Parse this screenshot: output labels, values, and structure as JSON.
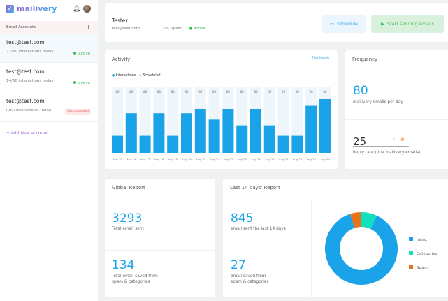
{
  "app": {
    "name": "mailivery",
    "brand_color": "#1aa3e8"
  },
  "sidebar": {
    "section_title": "Email Accounts",
    "add_icon": "plus-icon",
    "accounts": [
      {
        "email": "test@test.com",
        "interactions": "22/80 interactions today",
        "status": "active",
        "selected": true
      },
      {
        "email": "test@test.com",
        "interactions": "14/50 interactions today",
        "status": "active"
      },
      {
        "email": "test@test.com",
        "interactions": "0/60 interactions today",
        "status": "Disconnected"
      }
    ],
    "add_account": "+ Add New account"
  },
  "header": {
    "name": "Tester",
    "email": "test@test.com",
    "spam": "2% Spam",
    "status": "active",
    "schedule_label": "Schedule",
    "start_label": "Start sending emails"
  },
  "activity": {
    "title": "Activity",
    "period": "This Month",
    "legend_interactions": "Interactions",
    "legend_scheduled": "Scheduled"
  },
  "chart_data": {
    "type": "bar",
    "categories": [
      "Aug 15",
      "Aug 16",
      "Aug 17",
      "Aug 18",
      "Aug 18",
      "Aug 19",
      "Aug 20",
      "Aug 21",
      "Aug 22",
      "Aug 23",
      "Aug 24",
      "Aug 25",
      "Aug 26",
      "Aug 27",
      "Aug 28",
      "Aug 29"
    ],
    "series": [
      {
        "name": "Interactions",
        "values": [
          21,
          48,
          21,
          48,
          21,
          48,
          54,
          41,
          54,
          33,
          54,
          33,
          21,
          21,
          58,
          66
        ],
        "color": "#1aa3e8"
      },
      {
        "name": "Scheduled",
        "values": [
          80,
          80,
          80,
          80,
          80,
          80,
          80,
          80,
          80,
          80,
          80,
          80,
          80,
          80,
          80,
          80
        ],
        "color": "#eef6fc"
      }
    ],
    "ylim": [
      0,
      80
    ]
  },
  "frequency": {
    "title": "Frequency",
    "value": "80",
    "value_label": "mailivery emails per day",
    "reply_rate": "25",
    "reply_label": "Reply rate (one mailivery emails)"
  },
  "global_report": {
    "title": "Global Report",
    "total_sent": "3293",
    "total_sent_label": "Total email sent",
    "saved": "134",
    "saved_label_1": "Total email saved from",
    "saved_label_2": "spam & categories"
  },
  "last14": {
    "title": "Last 14 days' Report",
    "sent": "845",
    "sent_label": "email sent the last 14 days",
    "saved": "27",
    "saved_label_1": "email saved from",
    "saved_label_2": "spam & categories"
  },
  "donut": {
    "type": "pie",
    "slices": [
      {
        "label": "Categories",
        "value": 7,
        "color": "#12dfbb"
      },
      {
        "label": "Inbox",
        "value": 88,
        "color": "#1aa3e8"
      },
      {
        "label": "Spam",
        "value": 5,
        "color": "#e8731a"
      }
    ],
    "legend": [
      "Inbox",
      "Categories",
      "Spam"
    ]
  }
}
